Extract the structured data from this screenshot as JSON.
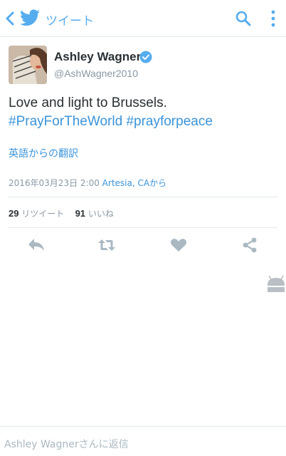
{
  "header": {
    "title": "ツイート"
  },
  "tweet": {
    "name": "Ashley Wagner",
    "handle": "@AshWagner2010",
    "text_plain": "Love and light to Brussels.",
    "hashtag1": "#PrayForTheWorld",
    "hashtag2": "#prayforpeace",
    "translate_label": "英語からの翻訳",
    "timestamp": "2016年03月23日 2:00",
    "location": "Artesia, CAから"
  },
  "stats": {
    "retweet_count": "29",
    "retweet_label": "リツイート",
    "like_count": "91",
    "like_label": "いいね"
  },
  "reply": {
    "placeholder": "Ashley Wagnerさんに返信"
  },
  "colors": {
    "accent": "#55acee",
    "link": "#3b94d9",
    "muted": "#8899a6",
    "icon": "#aab8c2"
  }
}
